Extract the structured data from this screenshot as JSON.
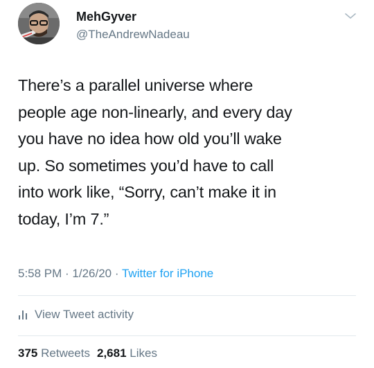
{
  "user": {
    "display_name": "MehGyver",
    "handle": "@TheAndrewNadeau",
    "avatar_icon": "profile-photo"
  },
  "tweet": {
    "lines": [
      "There’s a parallel universe where",
      "people age non-linearly, and every day",
      "you have no idea how old you’ll wake",
      "up. So sometimes you’d have to call",
      "into work like, “Sorry, can’t make it in",
      "today, I’m 7.”"
    ],
    "time": "5:58 PM",
    "date": "1/26/20",
    "separator": " · ",
    "source": "Twitter for iPhone"
  },
  "activity": {
    "icon": "bar-chart-icon",
    "label": "View Tweet activity"
  },
  "stats": {
    "retweets_count": "375",
    "retweets_label": "Retweets",
    "likes_count": "2,681",
    "likes_label": "Likes"
  },
  "colors": {
    "text": "#14171a",
    "secondary": "#657786",
    "link": "#1da1f2",
    "divider": "#e1e8ed"
  }
}
